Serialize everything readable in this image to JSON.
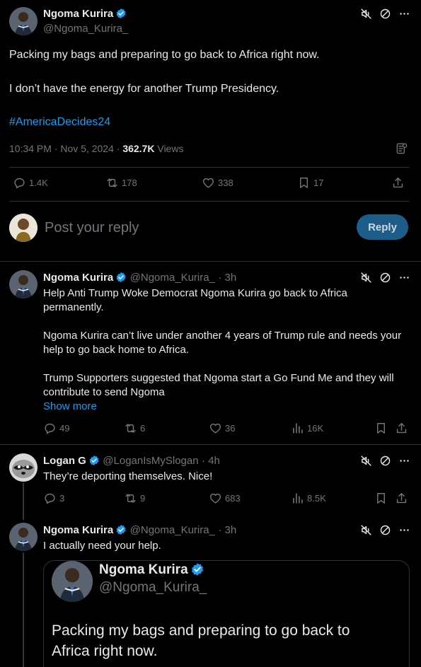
{
  "main_tweet": {
    "author_name": "Ngoma Kurira",
    "handle": "@Ngoma_Kurira_",
    "line1": "Packing my bags and preparing to go back to Africa right now.",
    "line2": "I don’t have the energy for another Trump Presidency.",
    "hashtag": "#AmericaDecides24",
    "timestamp": "10:34 PM · Nov 5, 2024 · ",
    "views_count": "362.7K",
    "views_label": " Views",
    "replies": "1.4K",
    "reposts": "178",
    "likes": "338",
    "bookmarks": "17"
  },
  "composer": {
    "placeholder": "Post your reply",
    "reply_button": "Reply"
  },
  "replies": [
    {
      "author_name": "Ngoma Kurira",
      "handle": "@Ngoma_Kurira_",
      "time": "· 3h",
      "p1": "Help Anti Trump Woke Democrat Ngoma Kurira go back to Africa permanently.",
      "p2": "Ngoma Kurira can’t live under another 4 years of Trump rule and needs your help to go back home to Africa.",
      "p3": "Trump Supporters suggested that Ngoma start a Go Fund Me and they will contribute to send Ngoma",
      "show_more": "Show more",
      "replies": "49",
      "reposts": "6",
      "likes": "36",
      "views": "16K"
    },
    {
      "author_name": "Logan G",
      "handle": "@LoganIsMySlogan",
      "time": "· 4h",
      "p1": "They’re deporting themselves. Nice!",
      "replies": "3",
      "reposts": "9",
      "likes": "683",
      "views": "8.5K"
    },
    {
      "author_name": "Ngoma Kurira",
      "handle": "@Ngoma_Kurira_",
      "time": "· 3h",
      "p1": "I actually need your help.",
      "quote": {
        "author_name": "Ngoma Kurira",
        "handle": "@Ngoma_Kurira_",
        "text": "Packing my bags and preparing to go back to Africa right now."
      }
    }
  ],
  "colors": {
    "accent": "#1d9bf0",
    "background": "#000000",
    "muted": "#71767b",
    "divider": "#2f3336"
  },
  "icons": [
    "verified-badge-icon",
    "mute-icon",
    "block-icon",
    "more-icon",
    "reply-icon",
    "repost-icon",
    "like-icon",
    "bookmark-icon",
    "share-icon",
    "views-icon",
    "analytics-icon"
  ]
}
